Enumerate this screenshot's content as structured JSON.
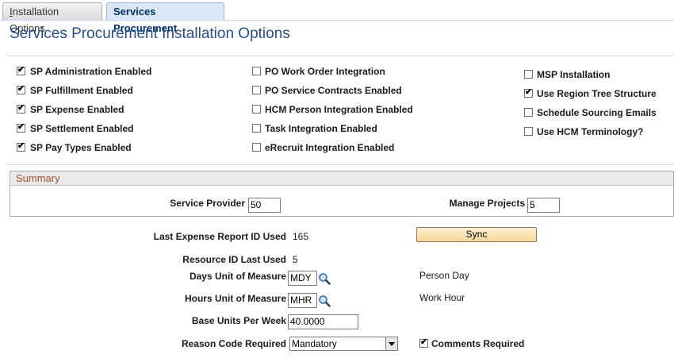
{
  "tabs": [
    {
      "label_first": "I",
      "label_rest": "nstallation Options"
    },
    {
      "label": "Services Procurement"
    }
  ],
  "page_title": "Services Procurement Installation Options",
  "options": {
    "col1": [
      {
        "label": "SP Administration Enabled",
        "checked": true
      },
      {
        "label": "SP Fulfillment Enabled",
        "checked": true
      },
      {
        "label": "SP Expense Enabled",
        "checked": true
      },
      {
        "label": "SP Settlement Enabled",
        "checked": true
      },
      {
        "label": "SP Pay Types Enabled",
        "checked": true
      }
    ],
    "col2": [
      {
        "label": "PO Work Order Integration",
        "checked": false
      },
      {
        "label": "PO Service Contracts Enabled",
        "checked": false
      },
      {
        "label": "HCM Person Integration Enabled",
        "checked": false
      },
      {
        "label": "Task Integration Enabled",
        "checked": false
      },
      {
        "label": "eRecruit Integration Enabled",
        "checked": false
      }
    ],
    "col3": [
      {
        "label": "MSP Installation",
        "checked": false
      },
      {
        "label": "Use Region Tree Structure",
        "checked": true
      },
      {
        "label": "Schedule Sourcing Emails",
        "checked": false
      },
      {
        "label": "Use HCM Terminology?",
        "checked": false
      }
    ]
  },
  "summary": {
    "title": "Summary",
    "service_provider_label": "Service Provider",
    "service_provider_value": "50",
    "manage_projects_label": "Manage Projects",
    "manage_projects_value": "5"
  },
  "fields": {
    "last_expense_label": "Last Expense Report ID Used",
    "last_expense_value": "165",
    "sync_label": "Sync",
    "resource_id_label": "Resource ID Last Used",
    "resource_id_value": "5",
    "days_uom_label": "Days Unit of Measure",
    "days_uom_value": "MDY",
    "days_uom_desc": "Person Day",
    "hours_uom_label": "Hours Unit of Measure",
    "hours_uom_value": "MHR",
    "hours_uom_desc": "Work Hour",
    "base_units_label": "Base Units Per Week",
    "base_units_value": "40.0000",
    "reason_code_label": "Reason Code Required",
    "reason_code_value": "Mandatory",
    "comments_required_label": "Comments Required",
    "comments_required_checked": true
  },
  "colors": {
    "title": "#2b4d8a",
    "summary_header_text": "#a0522d",
    "sync_button": "#f4d79a"
  },
  "icons": {
    "lookup": "magnifier-icon",
    "checkbox_mark": "check-icon",
    "dropdown": "chevron-down-icon"
  }
}
